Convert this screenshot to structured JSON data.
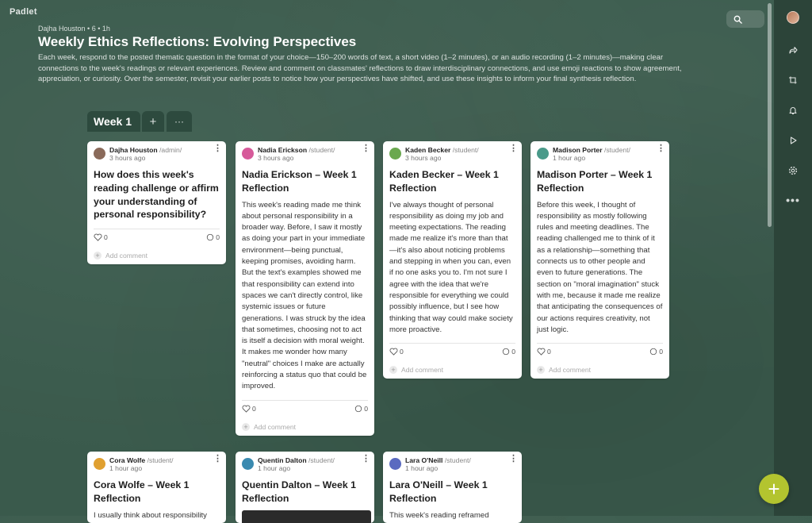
{
  "app": {
    "logo": "Padlet"
  },
  "board": {
    "meta": "Dajha Houston • 6 • 1h",
    "title": "Weekly Ethics Reflections: Evolving Perspectives",
    "description": "Each week, respond to the posted thematic question in the format of your choice—150–200 words of text, a short video (1–2 minutes), or an audio recording (1–2 minutes)—making clear connections to the week's readings or relevant experiences. Review and comment on classmates' reflections to draw interdisciplinary connections, and use emoji reactions to show agreement, appreciation, or curiosity. Over the semester, revisit your earlier posts to notice how your perspectives have shifted, and use these insights to inform your final synthesis reflection."
  },
  "section": {
    "title": "Week 1",
    "add_icon": "plus-icon",
    "more_icon": "ellipsis-icon"
  },
  "toolbar": {
    "search_icon": "search-icon",
    "rail": [
      "share-icon",
      "remake-icon",
      "bell-icon",
      "slideshow-icon",
      "gear-icon",
      "more-icon"
    ],
    "more_label": "•••"
  },
  "fab": {
    "label": "+"
  },
  "add_comment_label": "Add comment",
  "posts": [
    {
      "author": "Dajha Houston",
      "role": "/admin/",
      "time": "3 hours ago",
      "title": "How does this week's reading challenge or affirm your understanding of personal responsibility?",
      "body": "",
      "likes": "0",
      "comments": "0",
      "avatar_color": "#8a6a5a"
    },
    {
      "author": "Nadia Erickson",
      "role": "/student/",
      "time": "3 hours ago",
      "title": "Nadia Erickson – Week 1 Reflection",
      "body": "This week's reading made me think about personal responsibility in a broader way. Before, I saw it mostly as doing your part in your immediate environment—being punctual, keeping promises, avoiding harm. But the text's examples showed me that responsibility can extend into spaces we can't directly control, like systemic issues or future generations. I was struck by the idea that sometimes, choosing not to act is itself a decision with moral weight. It makes me wonder how many \"neutral\" choices I make are actually reinforcing a status quo that could be improved.",
      "likes": "0",
      "comments": "0",
      "avatar_color": "#d65a9a"
    },
    {
      "author": "Kaden Becker",
      "role": "/student/",
      "time": "3 hours ago",
      "title": "Kaden Becker – Week 1 Reflection",
      "body": "I've always thought of personal responsibility as doing my job and meeting expectations. The reading made me realize it's more than that—it's also about noticing problems and stepping in when you can, even if no one asks you to. I'm not sure I agree with the idea that we're responsible for everything we could possibly influence, but I see how thinking that way could make society more proactive.",
      "likes": "0",
      "comments": "0",
      "avatar_color": "#6aa84f"
    },
    {
      "author": "Madison Porter",
      "role": "/student/",
      "time": "1 hour ago",
      "title": "Madison Porter – Week 1 Reflection",
      "body": "Before this week, I thought of responsibility as mostly following rules and meeting deadlines. The reading challenged me to think of it as a relationship—something that connects us to other people and even to future generations. The section on \"moral imagination\" stuck with me, because it made me realize that anticipating the consequences of our actions requires creativity, not just logic.",
      "likes": "0",
      "comments": "0",
      "avatar_color": "#4a9a8a"
    },
    {
      "author": "Cora Wolfe",
      "role": "/student/",
      "time": "1 hour ago",
      "title": "Cora Wolfe – Week 1 Reflection",
      "body": "I usually think about responsibility",
      "likes": "",
      "comments": "",
      "avatar_color": "#e0a030"
    },
    {
      "author": "Quentin Dalton",
      "role": "/student/",
      "time": "1 hour ago",
      "title": "Quentin Dalton – Week 1 Reflection",
      "body": "",
      "likes": "",
      "comments": "",
      "avatar_color": "#3a8ab0"
    },
    {
      "author": "Lara O'Neill",
      "role": "/student/",
      "time": "1 hour ago",
      "title": "Lara O'Neill – Week 1 Reflection",
      "body": "This week's reading reframed",
      "likes": "",
      "comments": "",
      "avatar_color": "#5a6ac0"
    }
  ]
}
